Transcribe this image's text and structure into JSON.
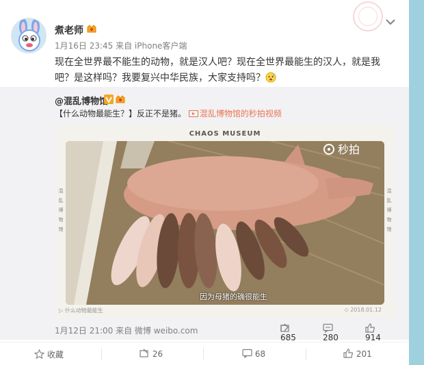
{
  "post": {
    "username": "煮老师",
    "meta": "1月16日 23:45 来自 iPhone客户端",
    "text_line1": "现在全世界最不能生的动物，就是汉人吧？现在全世界最能生的汉人，就是我",
    "text_line2": "吧？是这样吗？我要复兴中华民族，大家支持吗？"
  },
  "repost": {
    "author": "@混乱博物馆",
    "text": "【什么动物最能生？】反正不是猪。",
    "link": "混乱博物馆的秒拍视频",
    "video": {
      "header": "CHAOS MUSEUM",
      "watermark": "秒拍",
      "side_left": "混乱博物馆",
      "side_right": "混乱博物馆",
      "caption": "因为母猪的确很能生",
      "footer_left": "什么动物最能生",
      "footer_right": "2018.01.12"
    },
    "meta": "1月12日 21:00 来自 微博 weibo.com",
    "forward_count": "685",
    "comment_count": "280",
    "like_count": "914"
  },
  "actions": {
    "favorite": "收藏",
    "forward": "26",
    "comment": "68",
    "like": "201"
  }
}
